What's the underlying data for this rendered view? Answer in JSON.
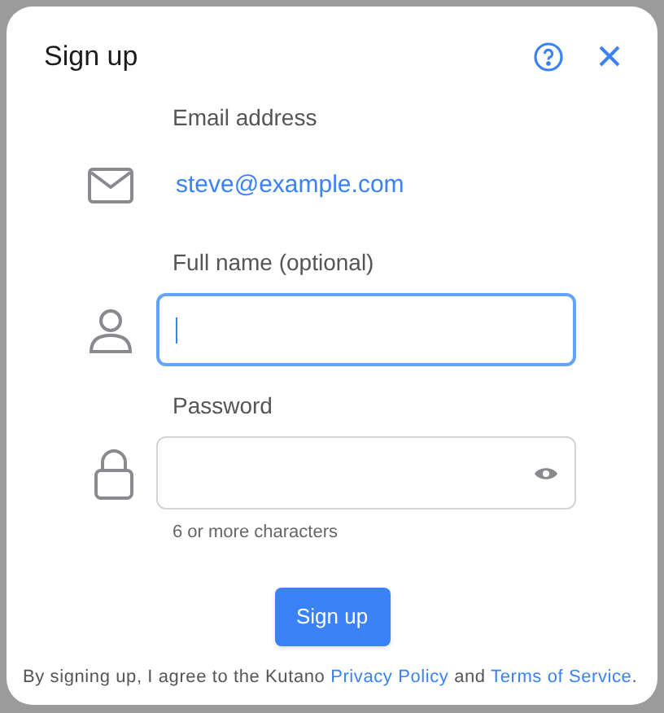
{
  "dialog": {
    "title": "Sign up"
  },
  "fields": [
    {
      "kind": "static",
      "label": "Email address",
      "value": "steve@example.com"
    },
    {
      "kind": "text",
      "label": "Full name (optional)",
      "focused": true
    },
    {
      "kind": "password",
      "label": "Password",
      "focused": false,
      "hint": "6 or more characters"
    }
  ],
  "submit": {
    "label": "Sign up"
  },
  "footer": [
    {
      "kind": "text",
      "text": "By signing up, I agree to the Kutano "
    },
    {
      "kind": "link",
      "text": "Privacy Policy"
    },
    {
      "kind": "text",
      "text": " and "
    },
    {
      "kind": "link",
      "text": "Terms of Service"
    },
    {
      "kind": "text",
      "text": "."
    }
  ]
}
